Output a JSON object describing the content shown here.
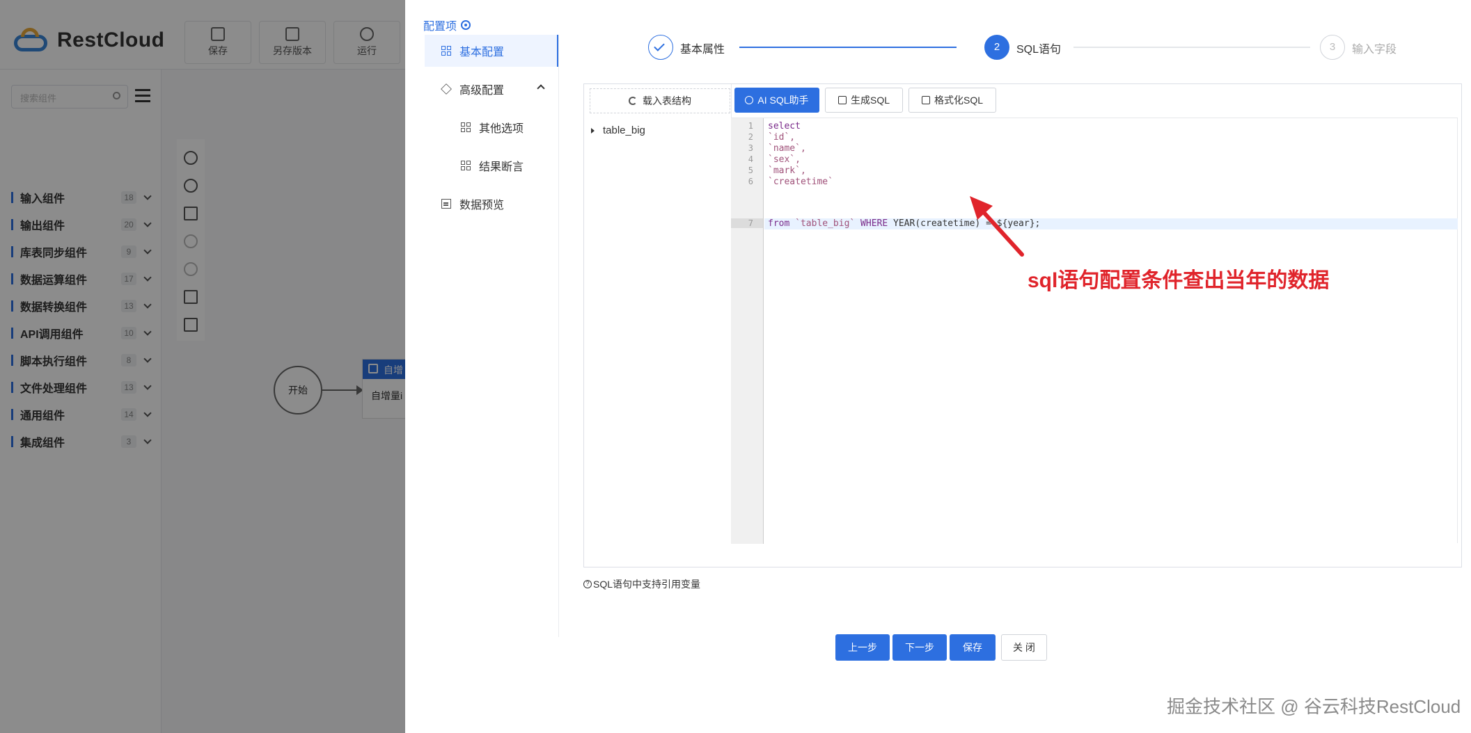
{
  "app": {
    "brand": "RestCloud",
    "toolbar": [
      {
        "label": "保存",
        "icon": "save-icon"
      },
      {
        "label": "另存版本",
        "icon": "save-version-icon"
      },
      {
        "label": "运行",
        "icon": "run-icon"
      }
    ],
    "sidebar": {
      "search_placeholder": "搜索组件",
      "categories": [
        {
          "name": "输入组件",
          "count": "18"
        },
        {
          "name": "输出组件",
          "count": "20"
        },
        {
          "name": "库表同步组件",
          "count": "9"
        },
        {
          "name": "数据运算组件",
          "count": "17"
        },
        {
          "name": "数据转换组件",
          "count": "13"
        },
        {
          "name": "API调用组件",
          "count": "10"
        },
        {
          "name": "脚本执行组件",
          "count": "8"
        },
        {
          "name": "文件处理组件",
          "count": "13"
        },
        {
          "name": "通用组件",
          "count": "14"
        },
        {
          "name": "集成组件",
          "count": "3"
        }
      ]
    },
    "canvas": {
      "start_label": "开始",
      "node_header": "自增",
      "node_body": "自增量i"
    }
  },
  "drawer": {
    "config_title": "配置项",
    "menu": [
      {
        "label": "基本配置",
        "icon": "grid-icon",
        "active": true
      },
      {
        "label": "高级配置",
        "icon": "cube-icon",
        "expanded": true
      },
      {
        "label": "其他选项",
        "icon": "grid-icon"
      },
      {
        "label": "结果断言",
        "icon": "grid-icon"
      },
      {
        "label": "数据预览",
        "icon": "table-icon"
      }
    ],
    "steps": [
      {
        "index": "1",
        "label": "基本属性",
        "status": "finish"
      },
      {
        "index": "2",
        "label": "SQL语句",
        "status": "process"
      },
      {
        "index": "3",
        "label": "输入字段",
        "status": "wait"
      }
    ],
    "editor": {
      "load_button": "载入表结构",
      "tree_table": "table_big",
      "buttons": {
        "ai_sql": "AI SQL助手",
        "gen_sql": "生成SQL",
        "format_sql": "格式化SQL"
      },
      "lines": [
        {
          "no": "1",
          "text": "select"
        },
        {
          "no": "2",
          "text": "`id`,"
        },
        {
          "no": "3",
          "text": "`name`,"
        },
        {
          "no": "4",
          "text": "`sex`,"
        },
        {
          "no": "5",
          "text": "`mark`,"
        },
        {
          "no": "6",
          "text": "`createtime`"
        },
        {
          "no": "7",
          "parts": [
            "from ",
            "`table_big`",
            " WHERE ",
            "YEAR(createtime) = ${year};"
          ]
        }
      ],
      "active_line": "7"
    },
    "hint": "SQL语句中支持引用变量",
    "footer": {
      "prev": "上一步",
      "next": "下一步",
      "save": "保存",
      "close": "关 闭"
    }
  },
  "annotation": "sql语句配置条件查出当年的数据",
  "watermark": "掘金技术社区 @ 谷云科技RestCloud",
  "colors": {
    "primary": "#2d6fe0",
    "annotation": "#e0242b",
    "overlay": "rgba(0,0,0,0.45)"
  }
}
